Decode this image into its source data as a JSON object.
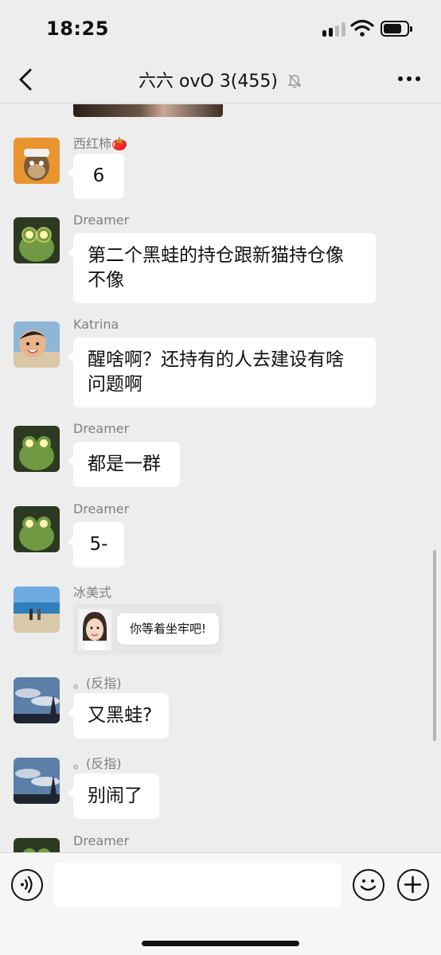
{
  "status_bar": {
    "time": "18:25"
  },
  "header": {
    "back_label": "",
    "title": "六六 ovO 3(455)",
    "muted": true
  },
  "messages": [
    {
      "sender": "西红柿🍅",
      "text": "6",
      "avatar": "bored-ape-avatar"
    },
    {
      "sender": "Dreamer",
      "text": "第二个黑蛙的持仓跟新猫持仓像不像",
      "avatar": "frog-avatar"
    },
    {
      "sender": "Katrina",
      "text": "醒啥啊？还持有的人去建设有啥问题啊",
      "avatar": "child-avatar"
    },
    {
      "sender": "Dreamer",
      "text": "都是一群",
      "avatar": "frog-avatar"
    },
    {
      "sender": "Dreamer",
      "text": "5-",
      "avatar": "frog-avatar"
    },
    {
      "sender": "冰美式",
      "sticker_text": "你等着坐牢吧!",
      "avatar": "beach-avatar"
    },
    {
      "sender": "。(反指)",
      "text": "又黑蛙?",
      "avatar": "sky-avatar"
    },
    {
      "sender": "。(反指)",
      "text": "别闹了",
      "avatar": "sky-avatar"
    },
    {
      "sender": "Dreamer",
      "text": "",
      "avatar": "frog-avatar"
    }
  ],
  "input": {
    "placeholder": ""
  },
  "colors": {
    "background": "#ededed",
    "bubble": "#ffffff",
    "sender": "#7f7f7f"
  }
}
